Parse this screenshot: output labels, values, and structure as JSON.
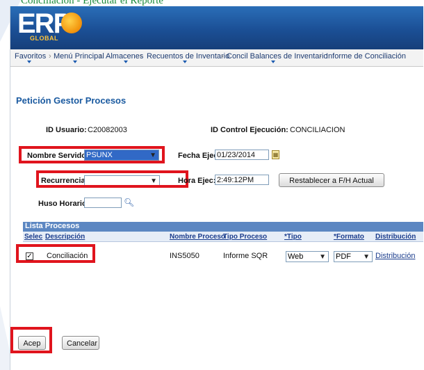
{
  "caption": "Conciliación - Ejecutar el Reporte",
  "brand": {
    "logo": "ERP",
    "sub": "GLOBAL"
  },
  "nav": {
    "items": [
      "Favoritos",
      "Menú Principal",
      "Almacenes",
      "Recuentos de Inventario",
      "Concil Balances de Inventario",
      "Informe de Conciliación"
    ],
    "separator": "›"
  },
  "page_title": "Petición Gestor Procesos",
  "form": {
    "user_label": "ID Usuario:",
    "user_value": "C20082003",
    "run_label": "ID Control Ejecución:",
    "run_value": "CONCILIACION",
    "server_label": "Nombre Servidor:",
    "server_value": "PSUNX",
    "date_label": "Fecha Ejec:",
    "date_value": "01/23/2014",
    "recurrence_label": "Recurrencia:",
    "recurrence_value": "",
    "time_label": "Hora Ejec:",
    "time_value": "2:49:12PM",
    "reset_button": "Restablecer a F/H Actual",
    "tz_label": "Huso Horario:",
    "tz_value": ""
  },
  "process_list": {
    "title": "Lista Procesos",
    "columns": [
      "Selec",
      "Descripción",
      "Nombre Proceso",
      "Tipo Proceso",
      "*Tipo",
      "*Formato",
      "Distribución"
    ],
    "rows": [
      {
        "selected": "✓",
        "description": "Conciliación",
        "process_name": "INS5050",
        "process_type": "Informe SQR",
        "type": "Web",
        "format": "PDF",
        "distribution": "Distribución"
      }
    ]
  },
  "buttons": {
    "accept": "Acep",
    "cancel": "Cancelar"
  },
  "colors": {
    "highlight": "#e0141d",
    "brand_blue": "#1b4f95",
    "title_blue": "#1a5aa0",
    "grid_header": "#5c87c2"
  }
}
